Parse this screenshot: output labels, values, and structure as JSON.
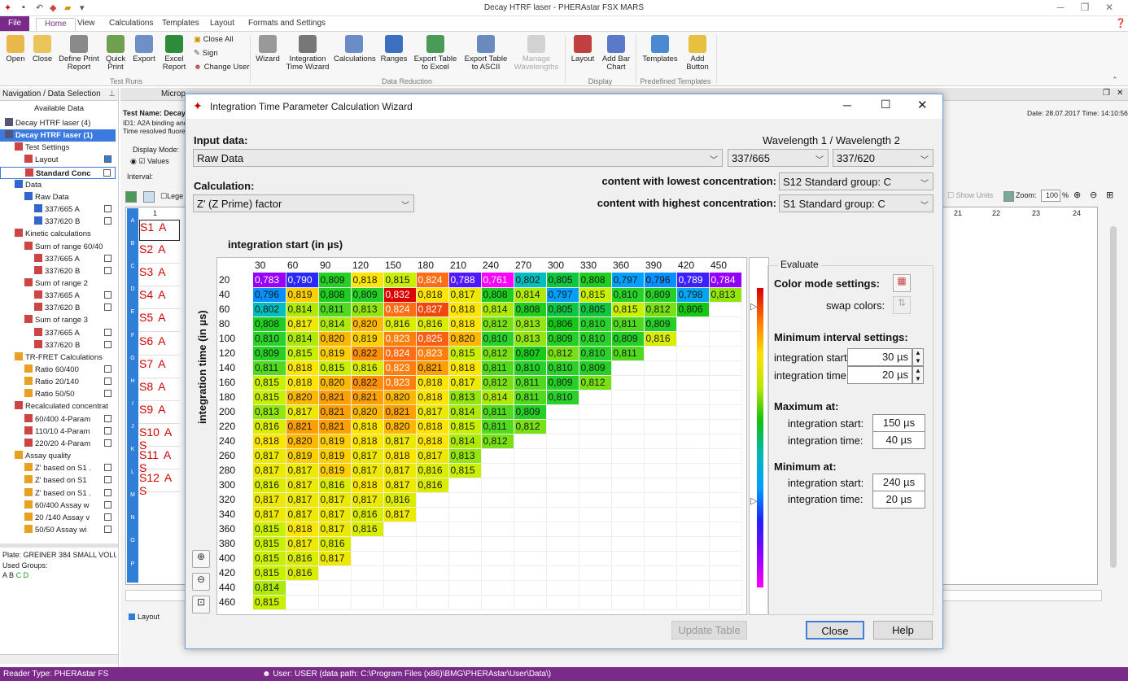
{
  "app": {
    "title": "Decay HTRF laser - PHERAstar FSX MARS"
  },
  "ribbon": {
    "tabs": [
      "File",
      "Home",
      "View",
      "Calculations",
      "Templates",
      "Layout",
      "Formats and Settings"
    ],
    "buttons": {
      "open": "Open",
      "close": "Close",
      "define_print": "Define Print Report",
      "quick_print": "Quick Print",
      "export": "Export",
      "excel_report": "Excel Report",
      "close_all": "Close All",
      "sign": "Sign",
      "change_user": "Change User",
      "wizard": "Wizard",
      "itw": "Integration Time Wizard",
      "calculations": "Calculations",
      "ranges": "Ranges",
      "export_excel": "Export Table to Excel",
      "export_ascii": "Export Table to ASCII",
      "manage_wl": "Manage Wavelengths",
      "layout": "Layout",
      "add_bar": "Add Bar Chart",
      "templates": "Templates",
      "add_button": "Add Button"
    },
    "groups": {
      "test_runs": "Test Runs",
      "data_reduction": "Data Reduction",
      "display": "Display",
      "predefined": "Predefined Templates"
    }
  },
  "nav": {
    "header": "Navigation / Data Selection",
    "available": "Available Data",
    "tree": [
      "Decay HTRF laser (4)",
      "Decay HTRF laser (1)",
      "Test Settings",
      "Layout",
      "Standard Conc",
      "Data",
      "Raw Data",
      "337/665 A",
      "337/620 B",
      "Kinetic calculations",
      "Sum of range 60/40",
      "337/665 A",
      "337/620 B",
      "Sum of range 2",
      "337/665 A",
      "337/620 B",
      "Sum of range 3",
      "337/665 A",
      "337/620 B",
      "TR-FRET Calculations",
      "Ratio 60/400",
      "Ratio 20/140",
      "Ratio 50/50",
      "Recalculated concentrat",
      "60/400 4-Param",
      "110/10 4-Param",
      "220/20 4-Param",
      "Assay quality",
      "Z' based on S1 .",
      "Z' based on S1",
      "Z' based on S1 .",
      "60/400 Assay w",
      "20 /140 Assay v",
      "50/50 Assay wi"
    ],
    "plate": "Plate: GREINER 384 SMALL VOLU",
    "used_groups": "Used Groups:",
    "groups": [
      "A",
      "B",
      "C",
      "D"
    ]
  },
  "background": {
    "tab_micro": "Microp",
    "test_name": "Test Name: Decay",
    "id1": "ID1: A2A binding and",
    "time_resolved": "Time resolved fluoresc",
    "date": "Date: 28.07.2017  Time: 14:10:56",
    "display_mode": "Display Mode:",
    "values": "Values",
    "interval": "Interval:",
    "legend": "Lege",
    "show_units": "Show Units",
    "zoom_label": "Zoom:",
    "zoom": "100",
    "pct": "%",
    "col1": "1",
    "cols": [
      "21",
      "22",
      "23",
      "24"
    ],
    "rows": [
      "A",
      "B",
      "C",
      "D",
      "E",
      "F",
      "G",
      "H",
      "I",
      "J",
      "K",
      "L",
      "M",
      "N",
      "O",
      "P"
    ],
    "wells": [
      "S1",
      "S2",
      "S3",
      "S4",
      "S5",
      "S6",
      "S7",
      "S8",
      "S9",
      "S10",
      "S11",
      "S12"
    ],
    "well_suffix": [
      "A",
      "A",
      "A",
      "A",
      "A",
      "A",
      "A",
      "A",
      "A",
      "A S",
      "A S",
      "A S"
    ],
    "layout_legend": "Layout"
  },
  "status": {
    "reader": "Reader Type: PHERAstar FS",
    "user": "User: USER  (data path: C:\\Program Files (x86)\\BMG\\PHERAstar\\User\\Data\\)"
  },
  "dialog": {
    "title": "Integration Time Parameter Calculation Wizard",
    "input_label": "Input data:",
    "input_value": "Raw Data",
    "wl_label": "Wavelength 1 / Wavelength 2",
    "wl1": "337/665",
    "wl2": "337/620",
    "calc_label": "Calculation:",
    "calc_value": "Z' (Z Prime) factor",
    "lowest_label": "content with lowest concentration:",
    "lowest_value": "S12 Standard group: C",
    "highest_label": "content with highest concentration:",
    "highest_value": "S1 Standard group: C",
    "x_title": "integration start (in µs)",
    "y_title": "integration time (in µs)",
    "evaluate": "Evaluate",
    "color_mode": "Color mode settings:",
    "swap": "swap colors:",
    "min_interval": "Minimum interval settings:",
    "int_start": "integration start:",
    "int_time": "integration time:",
    "min_start_val": "30 µs",
    "min_time_val": "20 µs",
    "max_at": "Maximum at:",
    "max_start": "150 µs",
    "max_time": "40 µs",
    "min_at": "Minimum at:",
    "mn_start": "240 µs",
    "mn_time": "20 µs",
    "update": "Update Table",
    "close": "Close",
    "help": "Help"
  },
  "grid": {
    "cols": [
      "30",
      "60",
      "90",
      "120",
      "150",
      "180",
      "210",
      "240",
      "270",
      "300",
      "330",
      "360",
      "390",
      "420",
      "450"
    ],
    "rows": [
      "20",
      "40",
      "60",
      "80",
      "100",
      "120",
      "140",
      "160",
      "180",
      "200",
      "220",
      "240",
      "260",
      "280",
      "300",
      "320",
      "340",
      "360",
      "380",
      "400",
      "420",
      "440",
      "460"
    ],
    "values": [
      [
        "0,783",
        "0,790",
        "0,809",
        "0,818",
        "0,815",
        "0,824",
        "0,788",
        "0,761",
        "0,802",
        "0,805",
        "0,808",
        "0,797",
        "0,796",
        "0,789",
        "0,784"
      ],
      [
        "0,796",
        "0,819",
        "0,808",
        "0,809",
        "0,832",
        "0,818",
        "0,817",
        "0,808",
        "0,814",
        "0,797",
        "0,815",
        "0,810",
        "0,809",
        "0,798",
        "0,813"
      ],
      [
        "0,802",
        "0,814",
        "0,811",
        "0,813",
        "0,824",
        "0,827",
        "0,818",
        "0,814",
        "0,808",
        "0,805",
        "0,805",
        "0,815",
        "0,812",
        "0,806"
      ],
      [
        "0,808",
        "0,817",
        "0,814",
        "0,820",
        "0,816",
        "0,816",
        "0,818",
        "0,812",
        "0,813",
        "0,806",
        "0,810",
        "0,811",
        "0,809"
      ],
      [
        "0,810",
        "0,814",
        "0,820",
        "0,819",
        "0,823",
        "0,825",
        "0,820",
        "0,810",
        "0,813",
        "0,809",
        "0,810",
        "0,809",
        "0,816"
      ],
      [
        "0,809",
        "0,815",
        "0,819",
        "0,822",
        "0,824",
        "0,823",
        "0,815",
        "0,812",
        "0,807",
        "0,812",
        "0,810",
        "0,811"
      ],
      [
        "0,811",
        "0,818",
        "0,815",
        "0,816",
        "0,823",
        "0,821",
        "0,818",
        "0,811",
        "0,810",
        "0,810",
        "0,809"
      ],
      [
        "0,815",
        "0,818",
        "0,820",
        "0,822",
        "0,823",
        "0,818",
        "0,817",
        "0,812",
        "0,811",
        "0,809",
        "0,812"
      ],
      [
        "0,815",
        "0,820",
        "0,821",
        "0,821",
        "0,820",
        "0,818",
        "0,813",
        "0,814",
        "0,811",
        "0,810"
      ],
      [
        "0,813",
        "0,817",
        "0,821",
        "0,820",
        "0,821",
        "0,817",
        "0,814",
        "0,811",
        "0,809"
      ],
      [
        "0,816",
        "0,821",
        "0,821",
        "0,818",
        "0,820",
        "0,818",
        "0,815",
        "0,811",
        "0,812"
      ],
      [
        "0,818",
        "0,820",
        "0,819",
        "0,818",
        "0,817",
        "0,818",
        "0,814",
        "0,812"
      ],
      [
        "0,817",
        "0,819",
        "0,819",
        "0,817",
        "0,818",
        "0,817",
        "0,813"
      ],
      [
        "0,817",
        "0,817",
        "0,819",
        "0,817",
        "0,817",
        "0,816",
        "0,815"
      ],
      [
        "0,816",
        "0,817",
        "0,816",
        "0,818",
        "0,817",
        "0,816"
      ],
      [
        "0,817",
        "0,817",
        "0,817",
        "0,817",
        "0,816"
      ],
      [
        "0,817",
        "0,817",
        "0,817",
        "0,816",
        "0,817"
      ],
      [
        "0,815",
        "0,818",
        "0,817",
        "0,816"
      ],
      [
        "0,815",
        "0,817",
        "0,816"
      ],
      [
        "0,815",
        "0,816",
        "0,817"
      ],
      [
        "0,815",
        "0,816"
      ],
      [
        "0,814"
      ],
      [
        "0,815"
      ]
    ]
  },
  "colors": {
    "accent": "#7a2b8a",
    "selection": "#3b7be0"
  }
}
